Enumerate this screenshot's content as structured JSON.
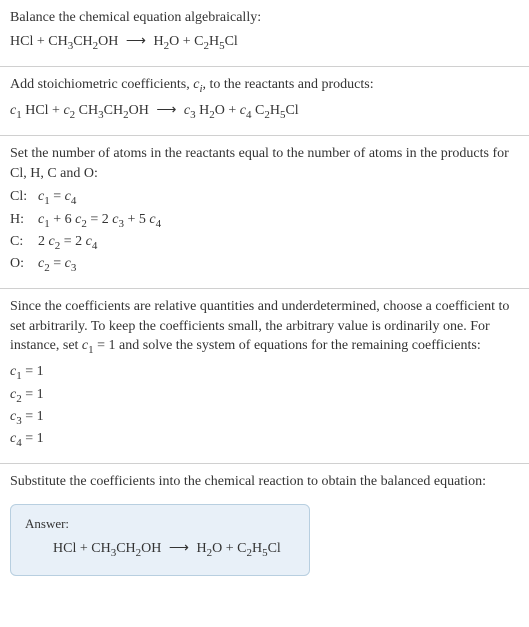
{
  "s1": {
    "title": "Balance the chemical equation algebraically:",
    "eq_lhs1": "HCl",
    "eq_plus1": " + ",
    "eq_lhs2a": "CH",
    "eq_lhs2a_sub": "3",
    "eq_lhs2b": "CH",
    "eq_lhs2b_sub": "2",
    "eq_lhs2c": "OH",
    "eq_arrow": " ⟶ ",
    "eq_rhs1a": "H",
    "eq_rhs1a_sub": "2",
    "eq_rhs1b": "O",
    "eq_plus2": " + ",
    "eq_rhs2a": "C",
    "eq_rhs2a_sub": "2",
    "eq_rhs2b": "H",
    "eq_rhs2b_sub": "5",
    "eq_rhs2c": "Cl"
  },
  "s2": {
    "title_a": "Add stoichiometric coefficients, ",
    "title_ci": "c",
    "title_ci_sub": "i",
    "title_b": ", to the reactants and products:",
    "c1": "c",
    "c1_sub": "1",
    "sp1": " HCl + ",
    "c2": "c",
    "c2_sub": "2",
    "sp2a": " CH",
    "sp2a_sub": "3",
    "sp2b": "CH",
    "sp2b_sub": "2",
    "sp2c": "OH",
    "arrow": " ⟶ ",
    "c3": "c",
    "c3_sub": "3",
    "sp3a": " H",
    "sp3a_sub": "2",
    "sp3b": "O + ",
    "c4": "c",
    "c4_sub": "4",
    "sp4a": " C",
    "sp4a_sub": "2",
    "sp4b": "H",
    "sp4b_sub": "5",
    "sp4c": "Cl"
  },
  "s3": {
    "title": "Set the number of atoms in the reactants equal to the number of atoms in the products for Cl, H, C and O:",
    "rows": [
      {
        "label": "Cl:",
        "c1": "c",
        "c1s": "1",
        "mid": " = ",
        "c2": "c",
        "c2s": "4",
        "tail": ""
      },
      {
        "label": "H:",
        "c1": "c",
        "c1s": "1",
        "mid": " + 6 ",
        "c2": "c",
        "c2s": "2",
        "mid2": " = 2 ",
        "c3": "c",
        "c3s": "3",
        "mid3": " + 5 ",
        "c4": "c",
        "c4s": "4"
      },
      {
        "label": "C:",
        "pre": "2 ",
        "c1": "c",
        "c1s": "2",
        "mid": " = 2 ",
        "c2": "c",
        "c2s": "4"
      },
      {
        "label": "O:",
        "c1": "c",
        "c1s": "2",
        "mid": " = ",
        "c2": "c",
        "c2s": "3"
      }
    ]
  },
  "s4": {
    "title_a": "Since the coefficients are relative quantities and underdetermined, choose a coefficient to set arbitrarily. To keep the coefficients small, the arbitrary value is ordinarily one. For instance, set ",
    "cset": "c",
    "cset_sub": "1",
    "title_b": " = 1 and solve the system of equations for the remaining coefficients:",
    "vals": [
      {
        "c": "c",
        "cs": "1",
        "eq": " = 1"
      },
      {
        "c": "c",
        "cs": "2",
        "eq": " = 1"
      },
      {
        "c": "c",
        "cs": "3",
        "eq": " = 1"
      },
      {
        "c": "c",
        "cs": "4",
        "eq": " = 1"
      }
    ]
  },
  "s5": {
    "title": "Substitute the coefficients into the chemical reaction to obtain the balanced equation:"
  },
  "answer": {
    "label": "Answer:",
    "eq_lhs1": "HCl",
    "eq_plus1": " + ",
    "eq_lhs2a": "CH",
    "eq_lhs2a_sub": "3",
    "eq_lhs2b": "CH",
    "eq_lhs2b_sub": "2",
    "eq_lhs2c": "OH",
    "eq_arrow": " ⟶ ",
    "eq_rhs1a": "H",
    "eq_rhs1a_sub": "2",
    "eq_rhs1b": "O",
    "eq_plus2": " + ",
    "eq_rhs2a": "C",
    "eq_rhs2a_sub": "2",
    "eq_rhs2b": "H",
    "eq_rhs2b_sub": "5",
    "eq_rhs2c": "Cl"
  }
}
